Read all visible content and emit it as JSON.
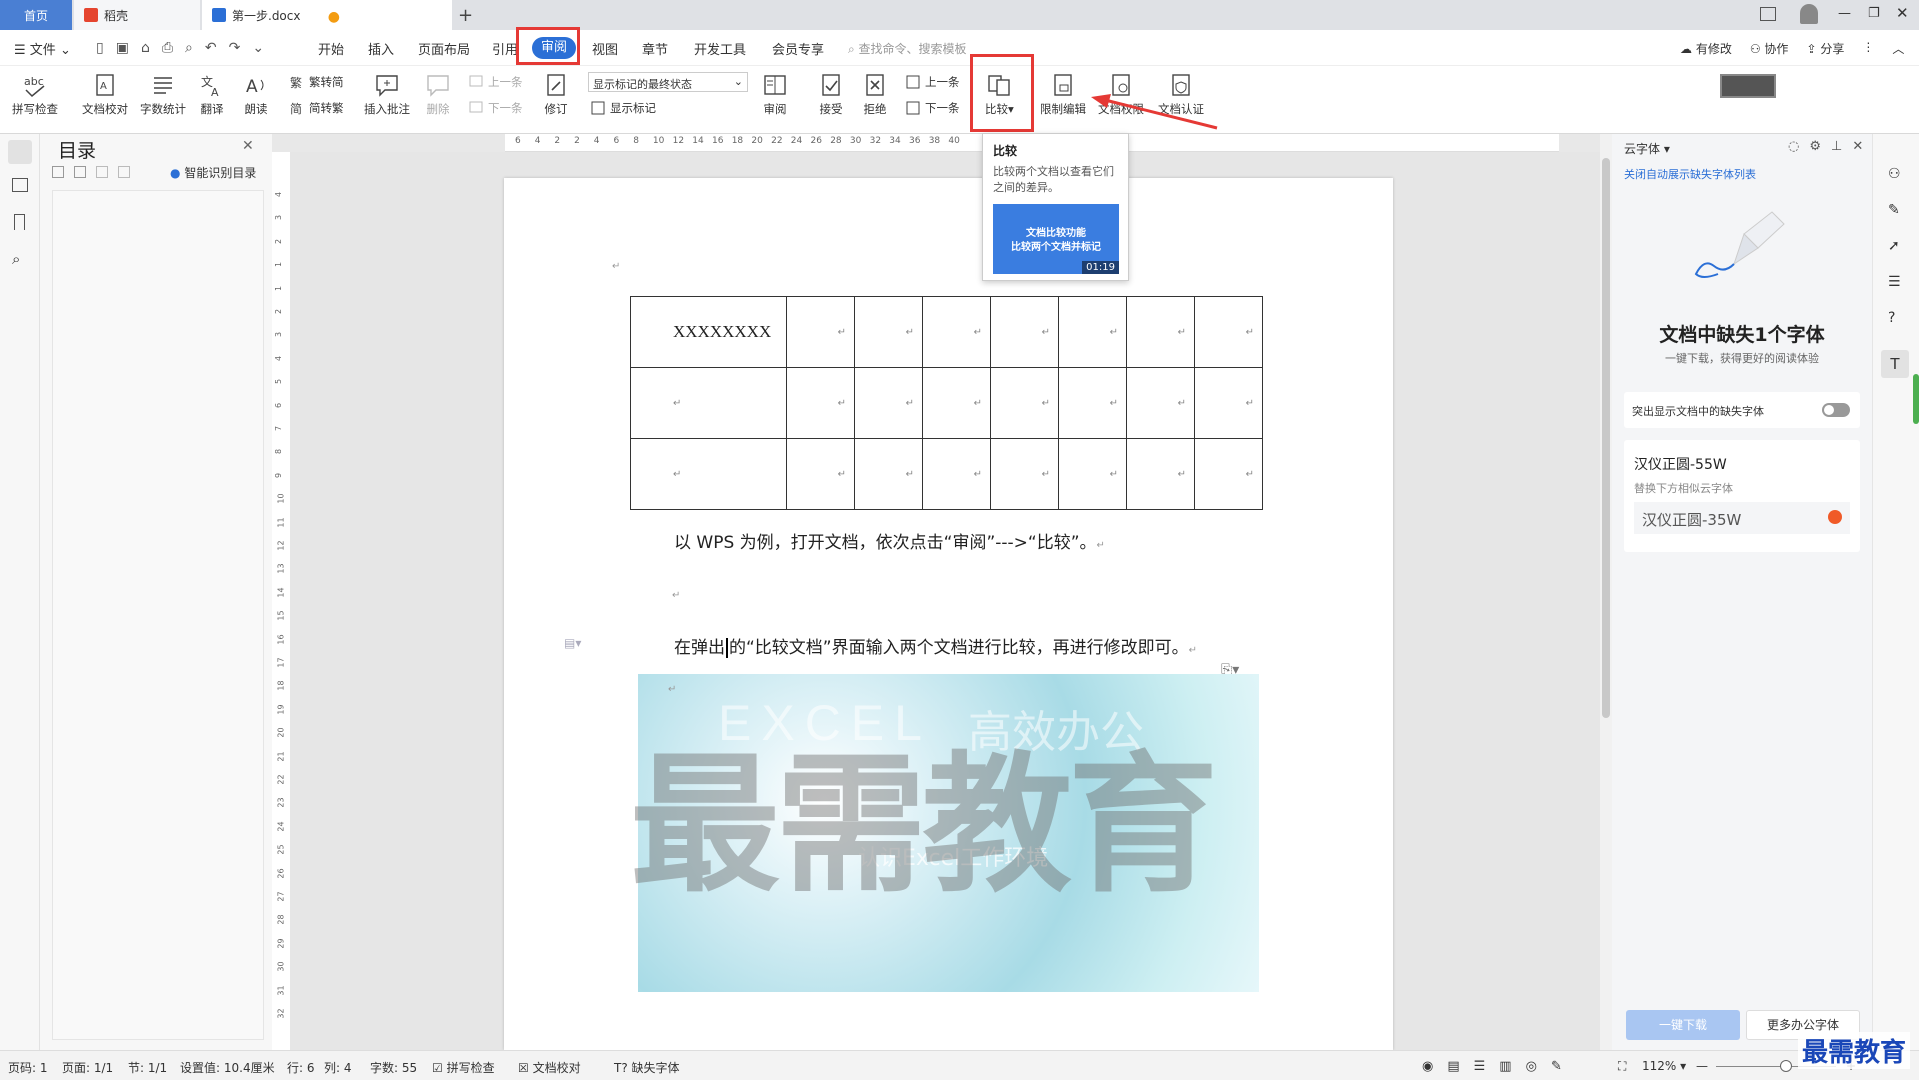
{
  "tabs": {
    "home": "首页",
    "daoke": "稻壳",
    "doc": "第一步.docx"
  },
  "menu": {
    "file": "文件",
    "items": [
      "开始",
      "插入",
      "页面布局",
      "引用",
      "审阅",
      "视图",
      "章节",
      "开发工具",
      "会员专享"
    ],
    "search_placeholder": "查找命令、搜索模板",
    "right": [
      "有修改",
      "协作",
      "分享"
    ]
  },
  "ribbon": {
    "spell_check": "拼写检查",
    "doc_proof": "文档校对",
    "word_count": "字数统计",
    "translate": "翻译",
    "read_aloud": "朗读",
    "trad_to_simp": "繁转简",
    "simp_to_trad": "简转繁",
    "insert_comment": "插入批注",
    "delete": "删除",
    "prev_comment": "上一条",
    "next_comment": "下一条",
    "revise": "修订",
    "markup_mode": "显示标记的最终状态",
    "show_markup": "显示标记",
    "review": "审阅",
    "accept": "接受",
    "reject": "拒绝",
    "prev_change": "上一条",
    "next_change": "下一条",
    "compare": "比较",
    "restrict_edit": "限制编辑",
    "doc_rights": "文档权限",
    "doc_cert": "文档认证"
  },
  "tooltip": {
    "title": "比较",
    "desc": "比较两个文档以查看它们之间的差异。",
    "thumb_line1": "文档比较功能",
    "thumb_line2": "比较两个文档并标记",
    "duration": "01:19"
  },
  "toc": {
    "title": "目录",
    "smart": "智能识别目录"
  },
  "ruler": {
    "h_ticks": [
      "6",
      "4",
      "2",
      "2",
      "4",
      "6",
      "8",
      "10",
      "12",
      "14",
      "16",
      "18",
      "20",
      "22",
      "24",
      "26",
      "28",
      "30",
      "32",
      "34",
      "36",
      "38",
      "40"
    ],
    "v_ticks": [
      "4",
      "3",
      "2",
      "1",
      "1",
      "2",
      "3",
      "4",
      "5",
      "6",
      "7",
      "8",
      "9",
      "10",
      "11",
      "12",
      "13",
      "14",
      "15",
      "16",
      "17",
      "18",
      "19",
      "20",
      "21",
      "22",
      "23",
      "24",
      "25",
      "26",
      "27",
      "28",
      "29",
      "30",
      "31",
      "32"
    ]
  },
  "document": {
    "cell_text": "XXXXXXXX",
    "para1": "以 WPS 为例，打开文档，依次点击“审阅”--->“比较”。",
    "para2_before": "在弹出",
    "para2_after": "的“比较文档”界面输入两个文档进行比较，再进行修改即可。",
    "image_text_en": "EXCEL",
    "image_text_cn": "高效办公",
    "image_sub": "认识Excel工作环境",
    "watermark": "最需教育"
  },
  "right_panel": {
    "title": "云字体",
    "link": "关闭自动展示缺失字体列表",
    "headline": "文档中缺失1个字体",
    "sub": "一键下载，获得更好的阅读体验",
    "toggle_label": "突出显示文档中的缺失字体",
    "font_name": "汉仪正圆-55W",
    "replace_hint": "替换下方相似云字体",
    "similar_font": "汉仪正圆-35W",
    "download_btn": "一键下载",
    "more_btn": "更多办公字体"
  },
  "status": {
    "page": "页码: 1",
    "pages": "页面: 1/1",
    "section": "节: 1/1",
    "setting": "设置值: 10.4厘米",
    "row": "行: 6",
    "col": "列: 4",
    "words": "字数: 55",
    "spell": "拼写检查",
    "proof": "文档校对",
    "missing_font": "缺失字体",
    "zoom": "112%"
  },
  "brand_watermark": "最需教育",
  "colors": {
    "accent": "#2b6fd6",
    "highlight_red": "#e53935",
    "tab_home": "#4a7fd3"
  }
}
